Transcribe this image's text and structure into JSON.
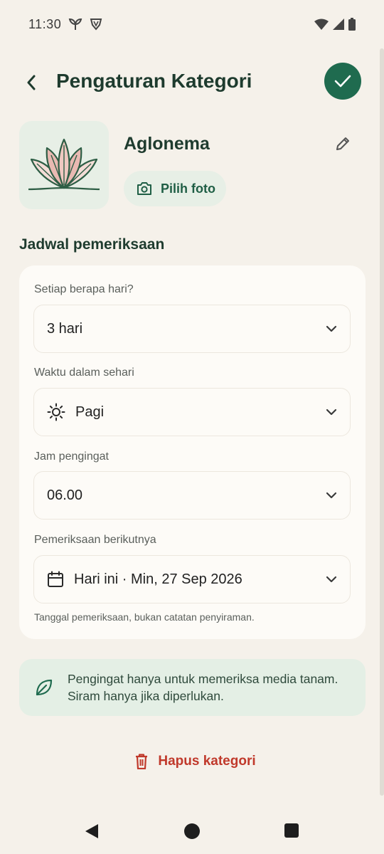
{
  "status_bar": {
    "time": "11:30"
  },
  "app_bar": {
    "title": "Pengaturan Kategori"
  },
  "category": {
    "name": "Aglonema",
    "photo_button_label": "Pilih foto"
  },
  "schedule": {
    "section_title": "Jadwal pemeriksaan",
    "interval_label": "Setiap berapa hari?",
    "interval_value": "3 hari",
    "time_of_day_label": "Waktu dalam sehari",
    "time_of_day_value": "Pagi",
    "reminder_label": "Jam pengingat",
    "reminder_value": "06.00",
    "next_check_label": "Pemeriksaan berikutnya",
    "next_check_value": "Hari ini · Min, 27 Sep 2026",
    "helper_text": "Tanggal pemeriksaan, bukan catatan penyiraman."
  },
  "info": {
    "line1": "Pengingat hanya untuk memeriksa media tanam.",
    "line2": "Siram hanya jika diperlukan."
  },
  "actions": {
    "delete_label": "Hapus kategori"
  },
  "colors": {
    "accent": "#1F6B4F",
    "danger": "#C0392B",
    "background": "#F5F1EA"
  }
}
